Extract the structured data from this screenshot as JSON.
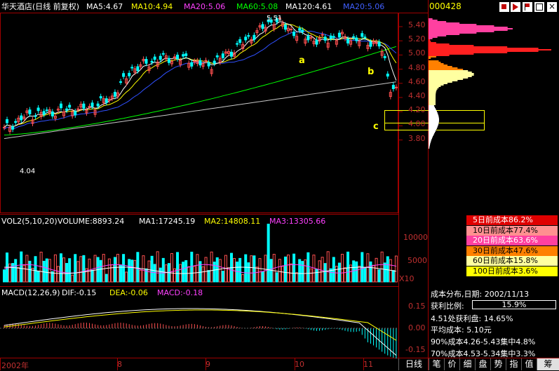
{
  "header": {
    "title": "华天酒店(日线 前复权)",
    "ma5": "MA5:4.67",
    "ma10": "MA10:4.94",
    "ma20": "MA20:5.06",
    "ma60": "MA60:5.08",
    "ma120": "MA120:4.61",
    "ma250": "MA20:5.06",
    "stock_code": "000428"
  },
  "price_axis": [
    "5.40",
    "5.20",
    "5.00",
    "4.80",
    "4.60",
    "4.40",
    "4.20",
    "4.00",
    "3.80"
  ],
  "annotations": {
    "high": "5.51",
    "low": "4.04",
    "a": "a",
    "b": "b",
    "c": "c"
  },
  "volume": {
    "label": "VOL2(5,10,20)",
    "value": "VOLUME:8893.24",
    "ma1": "MA1:17245.19",
    "ma2": "MA2:14808.11",
    "ma3": "MA3:13305.66",
    "axis": [
      "10000",
      "5000"
    ],
    "unit": "X10"
  },
  "macd": {
    "label": "MACD(12,26,9)",
    "dif": "DIF:-0.15",
    "dea": "DEA:-0.06",
    "macd": "MACD:-0.18",
    "axis": [
      "0.15",
      "0.00",
      "-0.15"
    ]
  },
  "dates": [
    "2002年",
    "8",
    "9",
    "10",
    "11"
  ],
  "cost": {
    "rows": [
      {
        "label": "5日前成本86.2%",
        "bg": "#e00000",
        "fg": "#ffffff"
      },
      {
        "label": "10日前成本77.4%",
        "bg": "#ff9090",
        "fg": "#000000"
      },
      {
        "label": "20日前成本63.6%",
        "bg": "#ff40a0",
        "fg": "#ffffff"
      },
      {
        "label": "30日前成本47.6%",
        "bg": "#ff8000",
        "fg": "#000000"
      },
      {
        "label": "60日前成本15.8%",
        "bg": "#ffffa0",
        "fg": "#000000"
      },
      {
        "label": "100日前成本3.6%",
        "bg": "#ffff00",
        "fg": "#000000"
      }
    ]
  },
  "info": {
    "dist_date": "成本分布,日期: 2002/11/13",
    "profit_label": "获利比例:",
    "profit_value": "15.9%",
    "profit_at": "4.51处获利盘: 14.65%",
    "avg_cost": "平均成本: 5.10元",
    "c90": "90%成本4.26-5.43集中4.8%",
    "c70": "70%成本4.53-5.34集中3.3%"
  },
  "bottom_tabs": [
    "日线",
    "笔",
    "价",
    "细",
    "盘",
    "势",
    "指",
    "值",
    "筹"
  ],
  "colors": {
    "up": "#ff5050",
    "down": "#00ffff",
    "ma5": "#ffffff",
    "ma10": "#ffff00",
    "ma20": "#ff40ff",
    "ma60": "#00ff00",
    "ma120": "#ffffff",
    "ma20b": "#4060ff"
  }
}
